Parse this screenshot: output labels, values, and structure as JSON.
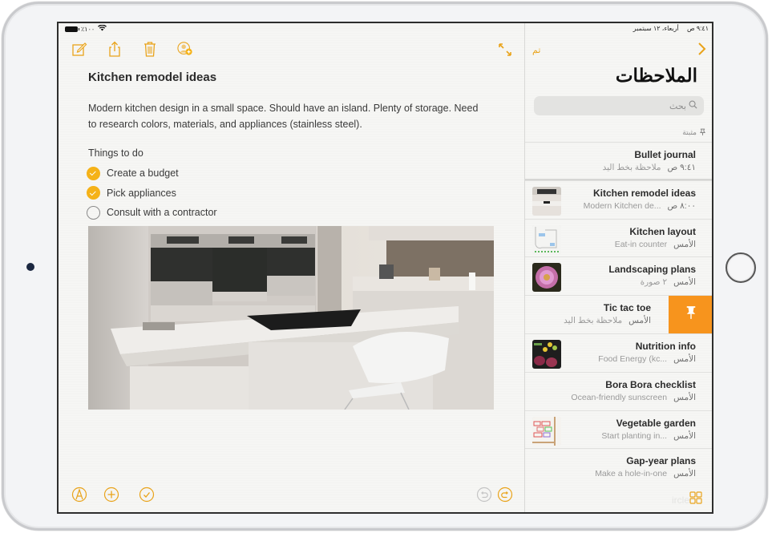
{
  "status_bar": {
    "battery_label": "٪١٠٠",
    "time": "٩:٤١ ص",
    "date": "أربعاء، ١٢ سبتمبر"
  },
  "detail": {
    "toolbar_icons": [
      "compose-icon",
      "share-icon",
      "trash-icon",
      "add-person-icon"
    ],
    "expand_icon": "expand-arrows-icon",
    "title": "Kitchen remodel ideas",
    "body": "Modern kitchen design in a small space. Should have an island. Plenty of storage. Need to research colors, materials, and appliances (stainless steel).",
    "checklist_heading": "Things to do",
    "checklist": [
      {
        "label": "Create a budget",
        "checked": true
      },
      {
        "label": "Pick appliances",
        "checked": true
      },
      {
        "label": "Consult with a contractor",
        "checked": false
      }
    ],
    "attachment": "kitchen-photo",
    "bottom_icons": {
      "left": [
        "markup-icon",
        "add-icon",
        "checklist-icon"
      ],
      "right": [
        "undo-icon",
        "redo-icon"
      ]
    }
  },
  "sidebar": {
    "done_label": "تم",
    "title": "الملاحظات",
    "search_placeholder": "بحث",
    "pinned_heading": "مثبتة",
    "notes": [
      {
        "title": "Bullet journal",
        "when": "٩:٤١ ص",
        "preview": "ملاحظة بخط اليد",
        "preview_rtl": true,
        "thumb": null,
        "pinned": true
      },
      {
        "title": "Kitchen remodel ideas",
        "when": "٨:٠٠ ص",
        "preview": "Modern Kitchen de...",
        "thumb": "kitchen"
      },
      {
        "title": "Kitchen layout",
        "when": "الأمس",
        "preview": "Eat-in counter",
        "thumb": "layout"
      },
      {
        "title": "Landscaping plans",
        "when": "الأمس",
        "preview": "٢ صورة",
        "preview_rtl": true,
        "thumb": "flower"
      },
      {
        "title": "Tic tac toe",
        "when": "الأمس",
        "preview": "ملاحظة بخط اليد",
        "preview_rtl": true,
        "thumb": null,
        "swiped": true
      },
      {
        "title": "Nutrition info",
        "when": "الأمس",
        "preview": "Food Energy (kc...",
        "thumb": "food"
      },
      {
        "title": "Bora Bora checklist",
        "when": "الأمس",
        "preview": "Ocean-friendly sunscreen",
        "thumb": null
      },
      {
        "title": "Vegetable garden",
        "when": "الأمس",
        "preview": "Start planting in...",
        "thumb": "garden"
      },
      {
        "title": "Gap-year plans",
        "when": "الأمس",
        "preview": "Make a hole-in-one",
        "thumb": null
      }
    ],
    "swipe_action": "pin-icon",
    "gallery_icon": "gallery-view-icon",
    "ghost_text": "ircle"
  },
  "colors": {
    "accent": "#F5B218",
    "swipe_pin": "#F7941D",
    "text_primary": "#2C2C2C",
    "text_secondary": "#9A9A9A"
  }
}
